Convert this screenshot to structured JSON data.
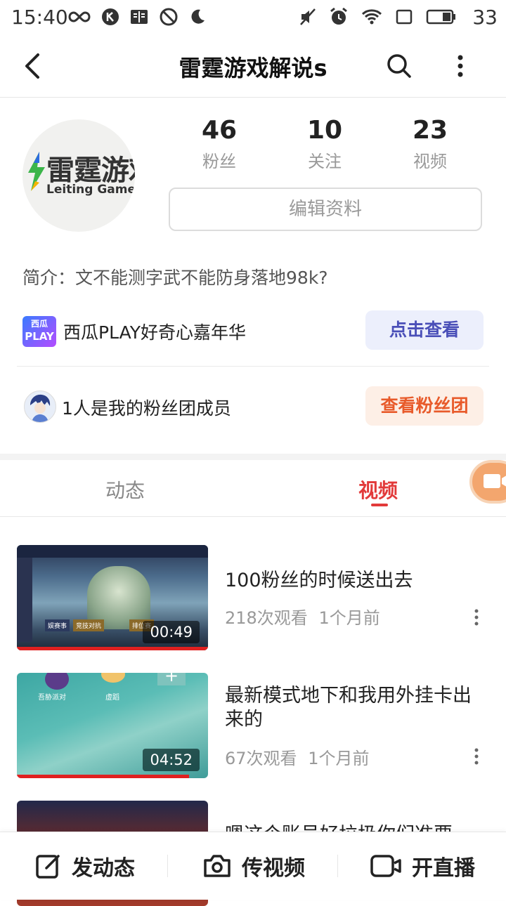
{
  "status_bar": {
    "time": "15:40",
    "battery": "33",
    "left_icons": [
      "infinity-icon",
      "k-app-icon",
      "book-icon",
      "block-icon",
      "moon-icon"
    ],
    "right_icons": [
      "mute-icon",
      "alarm-icon",
      "wifi-icon",
      "screen-icon",
      "battery-icon"
    ]
  },
  "header": {
    "title": "雷霆游戏解说s",
    "back_icon": "back-arrow-icon",
    "search_icon": "search-icon",
    "more_icon": "more-vertical-icon"
  },
  "profile": {
    "avatar_logo_cn": "雷霆游戏",
    "avatar_logo_en": "Leiting Games",
    "stats": [
      {
        "value": "46",
        "label": "粉丝"
      },
      {
        "value": "10",
        "label": "关注"
      },
      {
        "value": "23",
        "label": "视频"
      }
    ],
    "edit_button": "编辑资料",
    "bio": "简介：文不能测字武不能防身落地98k?"
  },
  "promo": {
    "badge_line1": "西瓜",
    "badge_line2": "PLAY",
    "text": "西瓜PLAY好奇心嘉年华",
    "button": "点击查看"
  },
  "fan_club": {
    "text": "1人是我的粉丝团成员",
    "button": "查看粉丝团"
  },
  "tabs": [
    {
      "label": "动态",
      "active": false
    },
    {
      "label": "视频",
      "active": true
    }
  ],
  "videos": [
    {
      "title": "100粉丝的时候送出去",
      "views": "218次观看",
      "time": "1个月前",
      "duration": "00:49",
      "progress": 1.0,
      "thumb_labels": [
        "娱赛事",
        "竞技对抗",
        "排位赛"
      ]
    },
    {
      "title": "最新模式地下和我用外挂卡出来的",
      "views": "67次观看",
      "time": "1个月前",
      "duration": "04:52",
      "progress": 0.9,
      "thumb_labels": [
        "吾胁派对",
        "虚蹈"
      ]
    },
    {
      "title": "嗯这个账号好垃圾你们准要",
      "views": "",
      "time": "",
      "duration": "",
      "progress": 0
    }
  ],
  "bottom_bar": [
    {
      "label": "发动态",
      "icon": "edit-icon"
    },
    {
      "label": "传视频",
      "icon": "camera-icon"
    },
    {
      "label": "开直播",
      "icon": "video-camera-icon"
    }
  ],
  "colors": {
    "accent_red": "#e23a3a",
    "view_button_text": "#4a4fb8",
    "fan_button_text": "#e85a2a",
    "float_button": "#f3a66e"
  }
}
